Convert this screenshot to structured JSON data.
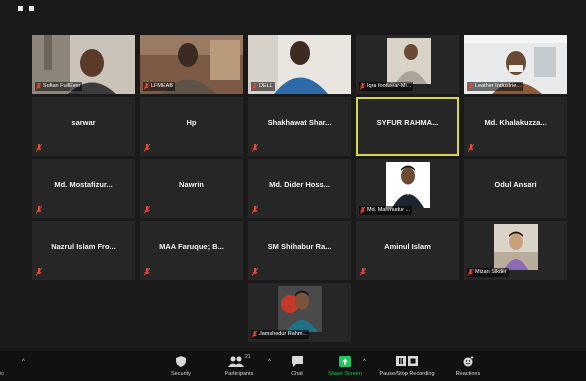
{
  "window": {
    "title": ""
  },
  "tiles": [
    {
      "name": "Sufian FullEver",
      "type": "video",
      "muted": true
    },
    {
      "name": "LFMEAB",
      "type": "video",
      "muted": true
    },
    {
      "name": "DELL",
      "type": "video",
      "muted": true
    },
    {
      "name": "Iqra footwear-Mi...",
      "type": "video",
      "muted": true
    },
    {
      "name": "Leather Industrie...",
      "type": "video",
      "muted": true
    },
    {
      "name": "sarwar",
      "type": "name",
      "muted": true
    },
    {
      "name": "Hp",
      "type": "name",
      "muted": true
    },
    {
      "name": "Shakhawat Shar...",
      "type": "name",
      "muted": true
    },
    {
      "name": "SYFUR RAHMA...",
      "type": "name",
      "muted": false,
      "active": true
    },
    {
      "name": "Md. Khalakuzza...",
      "type": "name",
      "muted": true
    },
    {
      "name": "Md. Mostafizur...",
      "type": "name",
      "muted": true
    },
    {
      "name": "Nawrin",
      "type": "name",
      "muted": true
    },
    {
      "name": "Md. Dider Hoss...",
      "type": "name",
      "muted": true
    },
    {
      "name": "Md. Mahmudur ...",
      "type": "photo",
      "muted": true
    },
    {
      "name": "Odul Ansari",
      "type": "name",
      "muted": false
    },
    {
      "name": "Nazrul Islam Fro...",
      "type": "name",
      "muted": true
    },
    {
      "name": "MAA Faruque; B...",
      "type": "name",
      "muted": true
    },
    {
      "name": "SM Shihabur Ra...",
      "type": "name",
      "muted": true
    },
    {
      "name": "Aminul Islam",
      "type": "name",
      "muted": true
    },
    {
      "name": "Mizan Sikder",
      "type": "photo",
      "muted": true
    },
    {
      "name": "Jamshedur Rahm...",
      "type": "photo",
      "muted": true
    }
  ],
  "toolbar": {
    "security": "Security",
    "participants": "Participants",
    "participants_count": "21",
    "chat": "Chat",
    "share_screen": "Share Screen",
    "recording": "Pause/Stop Recording",
    "reactions": "Reactions",
    "left_edge": "io"
  },
  "colors": {
    "background": "#1a1a1a",
    "tile": "#262626",
    "active_border": "#d6d84a",
    "muted_mic": "#e24a3b",
    "share_green": "#22c55e"
  }
}
